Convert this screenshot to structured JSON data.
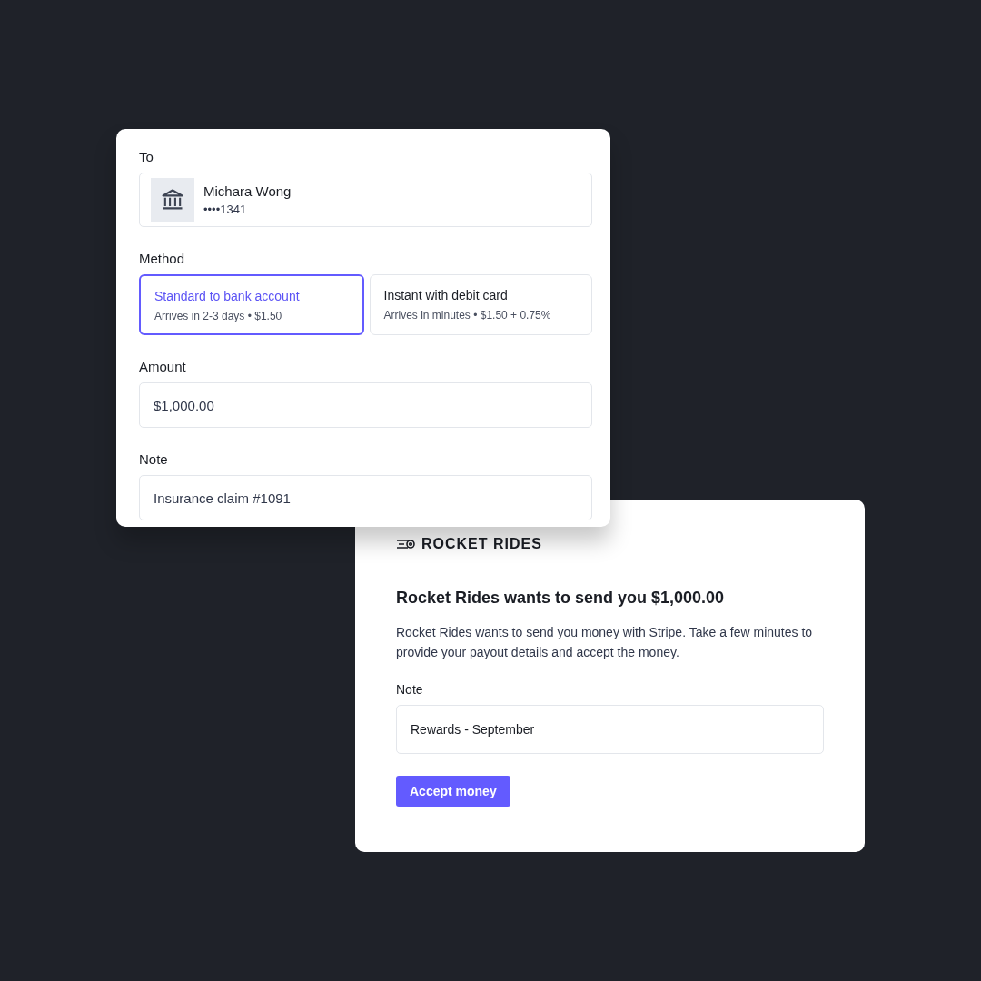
{
  "transfer_form": {
    "to_label": "To",
    "recipient": {
      "name": "Michara Wong",
      "account": "••••1341"
    },
    "method_label": "Method",
    "methods": [
      {
        "title": "Standard to bank account",
        "detail": "Arrives in 2-3 days • $1.50",
        "selected": true
      },
      {
        "title": "Instant with debit card",
        "detail": "Arrives in minutes • $1.50 + 0.75%",
        "selected": false
      }
    ],
    "amount_label": "Amount",
    "amount": "$1,000.00",
    "note_label": "Note",
    "note": "Insurance claim #1091"
  },
  "payout_card": {
    "brand": "ROCKET RIDES",
    "heading": "Rocket Rides wants to send you $1,000.00",
    "body": "Rocket Rides wants to send you money with Stripe. Take a few minutes to provide your payout details and accept the money.",
    "note_label": "Note",
    "note": "Rewards - September",
    "button": "Accept money"
  }
}
